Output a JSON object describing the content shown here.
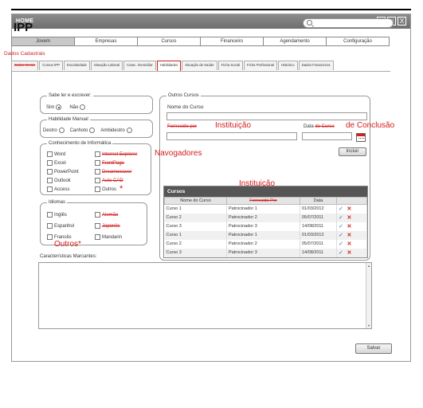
{
  "window": {
    "title": "HOME",
    "controls": [
      "_",
      "□",
      "X"
    ]
  },
  "app_name": "IPP",
  "search": {
    "placeholder": ""
  },
  "menu": [
    "Jovem",
    "Empresas",
    "Cursos",
    "Financeiro",
    "Agendamento",
    "Configuração"
  ],
  "section_label": "Dados Cadastrais",
  "tabs": [
    "Dados Gerais",
    "Cursos IPP",
    "Escolaridade",
    "Situação Laboral",
    "Carac. Domiciliar",
    "Habilidades",
    "Situação de Saúde",
    "Ficha Social",
    "Ficha Profissional",
    "Histórico",
    "Dados Financeiros"
  ],
  "literacy": {
    "legend": "Sabe ler e escrever:",
    "yes": "Sim",
    "no": "Não"
  },
  "handedness": {
    "legend": "Habilidade Manual",
    "options": [
      "Destro",
      "Canhoto",
      "Ambidestro"
    ]
  },
  "it_skills": {
    "legend": "Conhecimento de Informática",
    "left": [
      "Word",
      "Excel",
      "PowerPoint",
      "Outlook",
      "Access"
    ],
    "right": [
      "Internet Explorer",
      "FrontPage",
      "Dreamweaver",
      "Auto CAD",
      "Outros"
    ]
  },
  "languages": {
    "legend": "Idiomas",
    "left": [
      "Inglês",
      "Espanhol",
      "Francês"
    ],
    "right": [
      "Alemão",
      "Japonês",
      "Mandarin"
    ]
  },
  "courses": {
    "legend": "Outros Cursos",
    "name_label": "Nome do Curso",
    "provider_label": "Fornecido por",
    "date_label": "Data do Curso",
    "add_button": "Incluir"
  },
  "grid": {
    "title": "Cursos",
    "columns": [
      "Nome do Curso",
      "Fornecido Por",
      "Data"
    ],
    "rows": [
      [
        "Curso 1",
        "Patrocinador 1",
        "01/03/2012"
      ],
      [
        "Curso 2",
        "Patrocinador 2",
        "05/07/2011"
      ],
      [
        "Curso 3",
        "Patrocinador 3",
        "14/08/2011"
      ],
      [
        "Curso 1",
        "Patrocinador 1",
        "01/03/2012"
      ],
      [
        "Curso 2",
        "Patrocinador 2",
        "05/07/2011"
      ],
      [
        "Curso 3",
        "Patrocinador 3",
        "14/08/2011"
      ]
    ]
  },
  "traits_label": "Características Marcantes:",
  "save_button": "Salvar",
  "annotations": {
    "instituicao_1": "Instituição",
    "data_conclusao": "de Conclusão",
    "navegadores": "Navogadores",
    "instituicao_2": "Instituição",
    "outros": "Outros*",
    "asterisk": "*"
  },
  "colors": {
    "annotation": "#d21e1e",
    "titlebar": "#7d7d7d",
    "grid_header": "#555555"
  }
}
